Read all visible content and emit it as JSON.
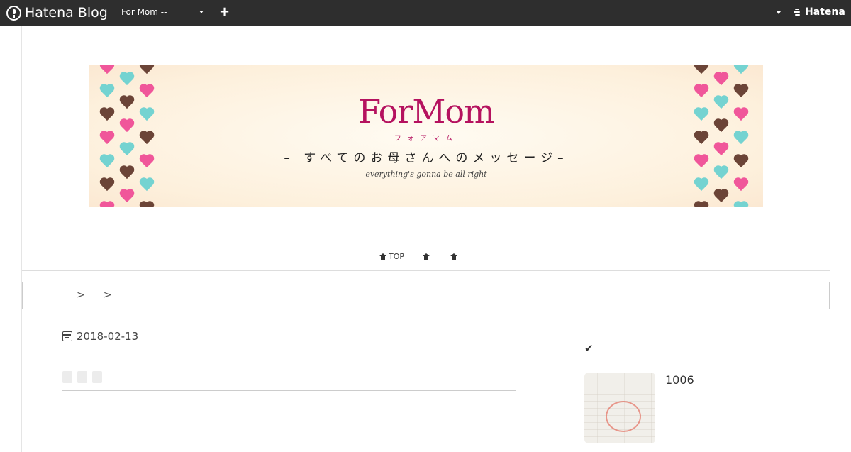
{
  "topbar": {
    "brand": "Hatena Blog",
    "blog_name": "For Mom --",
    "plus": "+",
    "hatena": "Hatena"
  },
  "banner": {
    "title": "ForMom",
    "kana": "フォアマム",
    "tagline": "– すべてのお母さんへのメッセージ–",
    "subtitle": "everything's gonna be all right",
    "colors": {
      "pink": "#f0569a",
      "teal": "#74d3d1",
      "brown": "#6b4437",
      "accent": "#b5125f"
    }
  },
  "nav": {
    "items": [
      {
        "label": "TOP"
      },
      {
        "label": ""
      },
      {
        "label": ""
      }
    ]
  },
  "breadcrumb": {
    "separators": [
      ">",
      ">"
    ]
  },
  "entry": {
    "date": "2018-02-13"
  },
  "sidebar": {
    "check": "✔",
    "count": "1006"
  }
}
